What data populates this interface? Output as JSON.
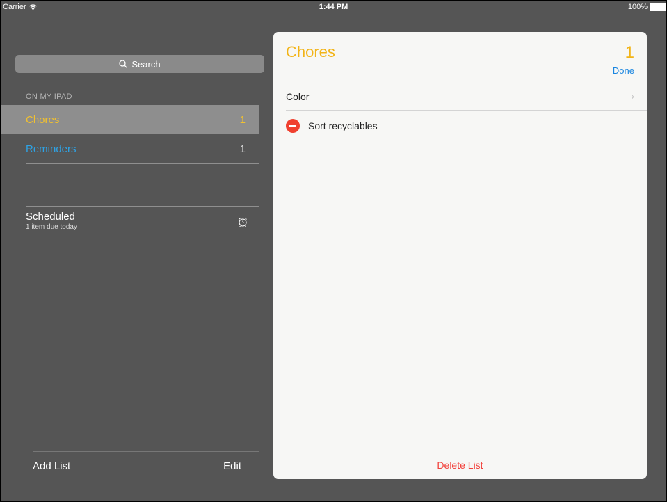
{
  "status_bar": {
    "carrier": "Carrier",
    "time": "1:44 PM",
    "battery": "100%",
    "wifi_icon": "wifi-icon",
    "battery_icon": "battery-icon"
  },
  "sidebar": {
    "search_placeholder": "Search",
    "search_icon": "search-icon",
    "section_header": "ON MY IPAD",
    "lists": [
      {
        "label": "Chores",
        "count": "1",
        "color": "#f2c12e",
        "selected": true
      },
      {
        "label": "Reminders",
        "count": "1",
        "color": "#2ea3e6",
        "selected": false
      }
    ],
    "scheduled": {
      "title": "Scheduled",
      "subtitle": "1 item due today",
      "icon": "alarm-clock-icon"
    },
    "toolbar": {
      "add_list": "Add List",
      "edit": "Edit"
    }
  },
  "detail": {
    "list_title": "Chores",
    "count": "1",
    "done_label": "Done",
    "color_label": "Color",
    "items": [
      {
        "label": "Sort recyclables",
        "icon": "delete-minus-icon"
      }
    ],
    "delete_list_label": "Delete List",
    "accent_color": "#f2b418"
  }
}
